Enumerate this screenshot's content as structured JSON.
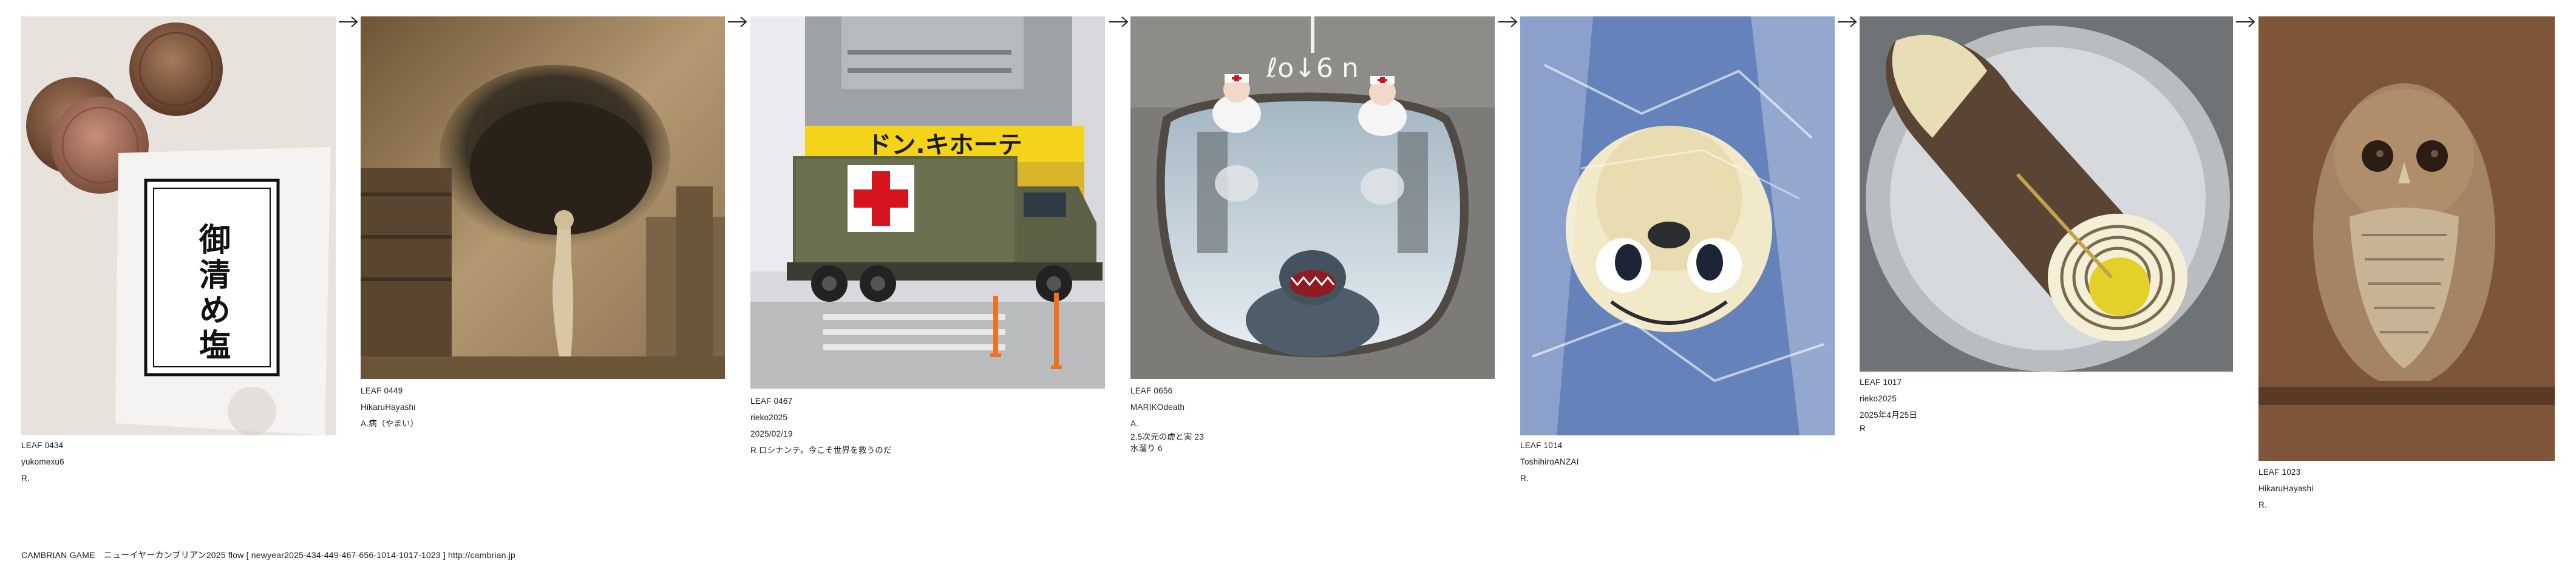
{
  "leaves": [
    {
      "id": "LEAF 0434",
      "author": "yukomexu6",
      "lines": [
        "R."
      ],
      "image": "coins-and-purifying-salt-packet",
      "salt_text": "御清め塩"
    },
    {
      "id": "LEAF 0449",
      "author": "HikaruHayashi",
      "lines": [
        "A.病（やまい）"
      ],
      "image": "sepia-figure-with-dark-cloud"
    },
    {
      "id": "LEAF 0467",
      "author": "rieko2025",
      "lines": [
        "2025/02/19",
        "R ロシナンテ。今こそ世界を救うのだ"
      ],
      "image": "red-cross-truck-at-don-quijote",
      "sign_text": "ドン.キホーテ"
    },
    {
      "id": "LEAF 0656",
      "author": "MARIKOdeath",
      "lines": [
        "A.",
        "2.5次元の虚と実 23",
        "水溜り 6"
      ],
      "image": "puddle-reflection-nurses-and-shark",
      "road_text": "ℓo↓6 n"
    },
    {
      "id": "LEAF 1014",
      "author": "ToshihiroANZAI",
      "lines": [
        "R."
      ],
      "image": "cartoon-face-under-plastic-wrap"
    },
    {
      "id": "LEAF 1017",
      "author": "rieko2025",
      "lines": [
        "2025年4月25日",
        "R"
      ],
      "image": "bamboo-shoot-cross-section"
    },
    {
      "id": "LEAF 1023",
      "author": "HikaruHayashi",
      "lines": [
        "R."
      ],
      "image": "brown-owl-on-perch"
    }
  ],
  "arrow_icon": "right-arrow-icon",
  "footer": "CAMBRIAN GAME　ニューイヤーカンブリアン2025  flow [ newyear2025-434-449-467-656-1014-1017-1023 ]    http://cambrian.jp"
}
